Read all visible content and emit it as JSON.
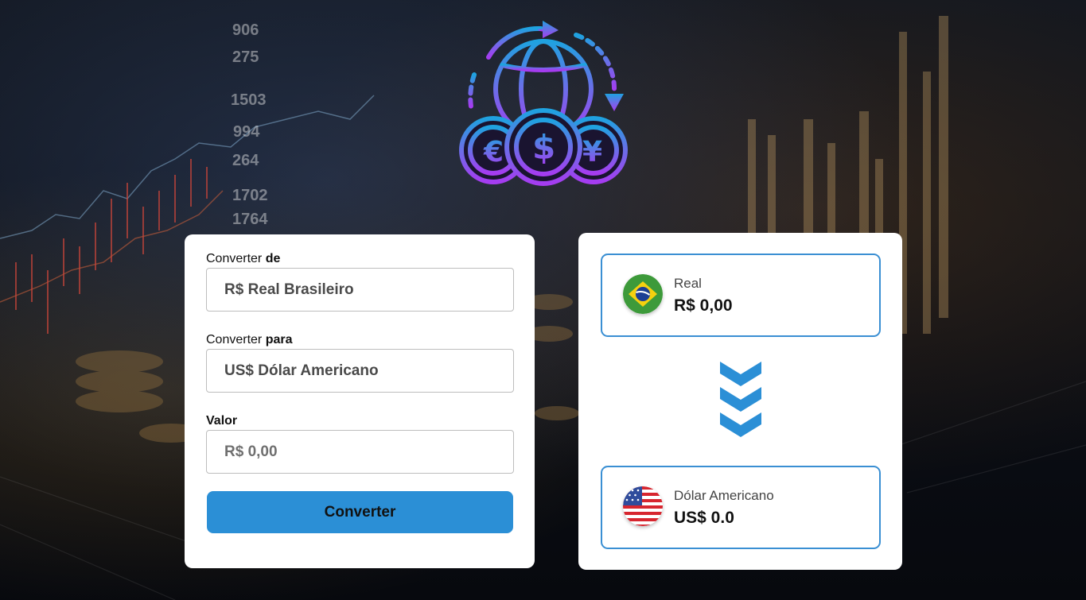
{
  "form": {
    "from_label_prefix": "Converter",
    "from_label_bold": "de",
    "from_selected": "R$ Real Brasileiro",
    "to_label_prefix": "Converter",
    "to_label_bold": "para",
    "to_selected": "US$ Dólar Americano",
    "value_label": "Valor",
    "value_placeholder": "R$ 0,00",
    "convert_button": "Converter"
  },
  "result": {
    "from": {
      "name": "Real",
      "value": "R$ 0,00",
      "flag": "brazil-flag-icon"
    },
    "to": {
      "name": "Dólar Americano",
      "value": "US$ 0.0",
      "flag": "usa-flag-icon"
    },
    "arrow_icon": "triple-chevron-down-icon"
  },
  "colors": {
    "accent": "#2b8fd6",
    "box_border": "#3a8fd3",
    "logo_gradient_top": "#1fa2e0",
    "logo_gradient_bottom": "#a53cf0"
  }
}
